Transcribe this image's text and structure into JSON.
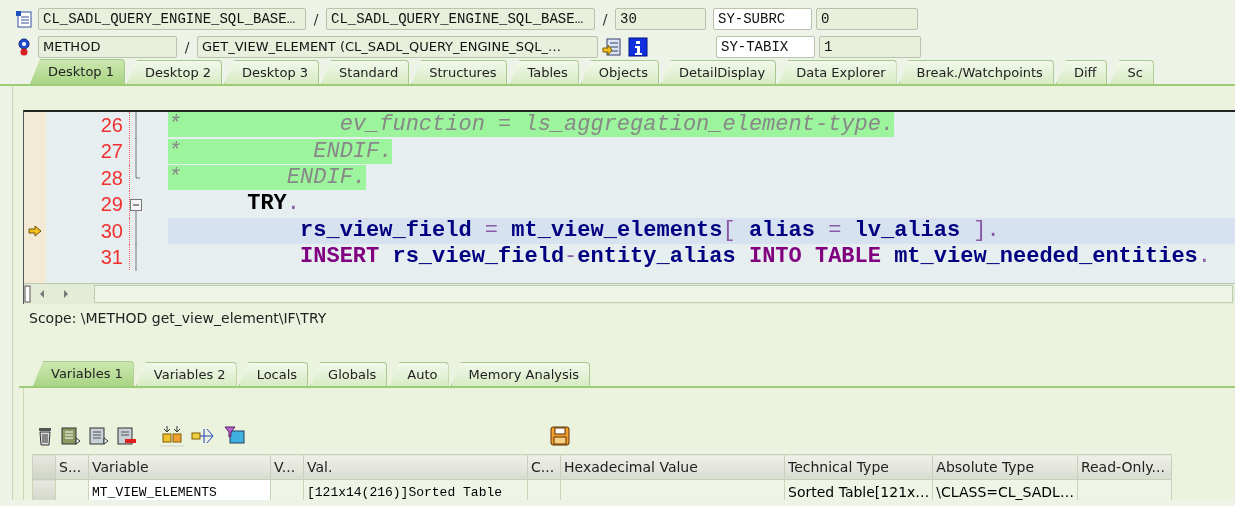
{
  "header": {
    "program": "CL_SADL_QUERY_ENGINE_SQL_BASE…",
    "program_separator": "/",
    "include": "CL_SADL_QUERY_ENGINE_SQL_BASE…",
    "include_separator": "/",
    "line": "30",
    "event_type": "METHOD",
    "event_separator": "/",
    "event": "GET_VIEW_ELEMENT (CL_SADL_QUERY_ENGINE_SQL_…",
    "system_fields": [
      {
        "name": "SY-SUBRC",
        "value": "0"
      },
      {
        "name": "SY-TABIX",
        "value": "1"
      }
    ]
  },
  "tabs": [
    {
      "label": "Desktop 1",
      "selected": true
    },
    {
      "label": "Desktop 2",
      "selected": false
    },
    {
      "label": "Desktop 3",
      "selected": false
    },
    {
      "label": "Standard",
      "selected": false
    },
    {
      "label": "Structures",
      "selected": false
    },
    {
      "label": "Tables",
      "selected": false
    },
    {
      "label": "Objects",
      "selected": false
    },
    {
      "label": "DetailDisplay",
      "selected": false
    },
    {
      "label": "Data Explorer",
      "selected": false
    },
    {
      "label": "Break./Watchpoints",
      "selected": false
    },
    {
      "label": "Diff",
      "selected": false
    },
    {
      "label": "Sc",
      "selected": false
    }
  ],
  "editor": {
    "lines": [
      {
        "number": "26",
        "fold": {
          "kind": "line"
        },
        "current": false,
        "tokens": [
          {
            "kind": "comment",
            "text": "*            ev_function = ls_aggregation_element-type."
          }
        ]
      },
      {
        "number": "27",
        "fold": {
          "kind": "line"
        },
        "current": false,
        "tokens": [
          {
            "kind": "comment",
            "text": "*          ENDIF."
          }
        ]
      },
      {
        "number": "28",
        "fold": {
          "kind": "end"
        },
        "current": false,
        "tokens": [
          {
            "kind": "comment",
            "text": "*        ENDIF."
          }
        ]
      },
      {
        "number": "29",
        "fold": {
          "kind": "open"
        },
        "current": false,
        "tokens": [
          {
            "kind": "statement",
            "text": "      TRY"
          },
          {
            "kind": "op",
            "text": "."
          }
        ]
      },
      {
        "number": "30",
        "fold": {
          "kind": "line"
        },
        "current": true,
        "tokens": [
          {
            "kind": "name",
            "text": "          rs_view_field"
          },
          {
            "kind": "op",
            "text": " = "
          },
          {
            "kind": "name",
            "text": "mt_view_elements"
          },
          {
            "kind": "op",
            "text": "[ "
          },
          {
            "kind": "name",
            "text": "alias"
          },
          {
            "kind": "op",
            "text": " = "
          },
          {
            "kind": "name",
            "text": "lv_alias"
          },
          {
            "kind": "op",
            "text": " ]."
          }
        ]
      },
      {
        "number": "31",
        "fold": {
          "kind": "line"
        },
        "current": false,
        "tokens": [
          {
            "kind": "keyword",
            "text": "          INSERT"
          },
          {
            "kind": "name",
            "text": " rs_view_field"
          },
          {
            "kind": "op",
            "text": "-"
          },
          {
            "kind": "name",
            "text": "entity_alias"
          },
          {
            "kind": "keyword",
            "text": " INTO TABLE "
          },
          {
            "kind": "name",
            "text": "mt_view_needed_entities"
          },
          {
            "kind": "op",
            "text": "."
          }
        ]
      }
    ]
  },
  "scope": "Scope: \\METHOD get_view_element\\IF\\TRY",
  "variable_tabs": [
    {
      "label": "Variables 1",
      "selected": true
    },
    {
      "label": "Variables 2",
      "selected": false
    },
    {
      "label": "Locals",
      "selected": false
    },
    {
      "label": "Globals",
      "selected": false
    },
    {
      "label": "Auto",
      "selected": false
    },
    {
      "label": "Memory Analysis",
      "selected": false
    }
  ],
  "table": {
    "columns": [
      "S...",
      "Variable",
      "V...",
      "Val.",
      "C...",
      "Hexadecimal Value",
      "Technical Type",
      "Absolute Type",
      "Read-Only..."
    ],
    "rows": [
      [
        "",
        "MT_VIEW_ELEMENTS",
        "",
        "[121x14(216)]Sorted Table",
        "",
        "",
        "Sorted Table[121x…",
        "\\CLASS=CL_SADL…",
        ""
      ]
    ]
  }
}
